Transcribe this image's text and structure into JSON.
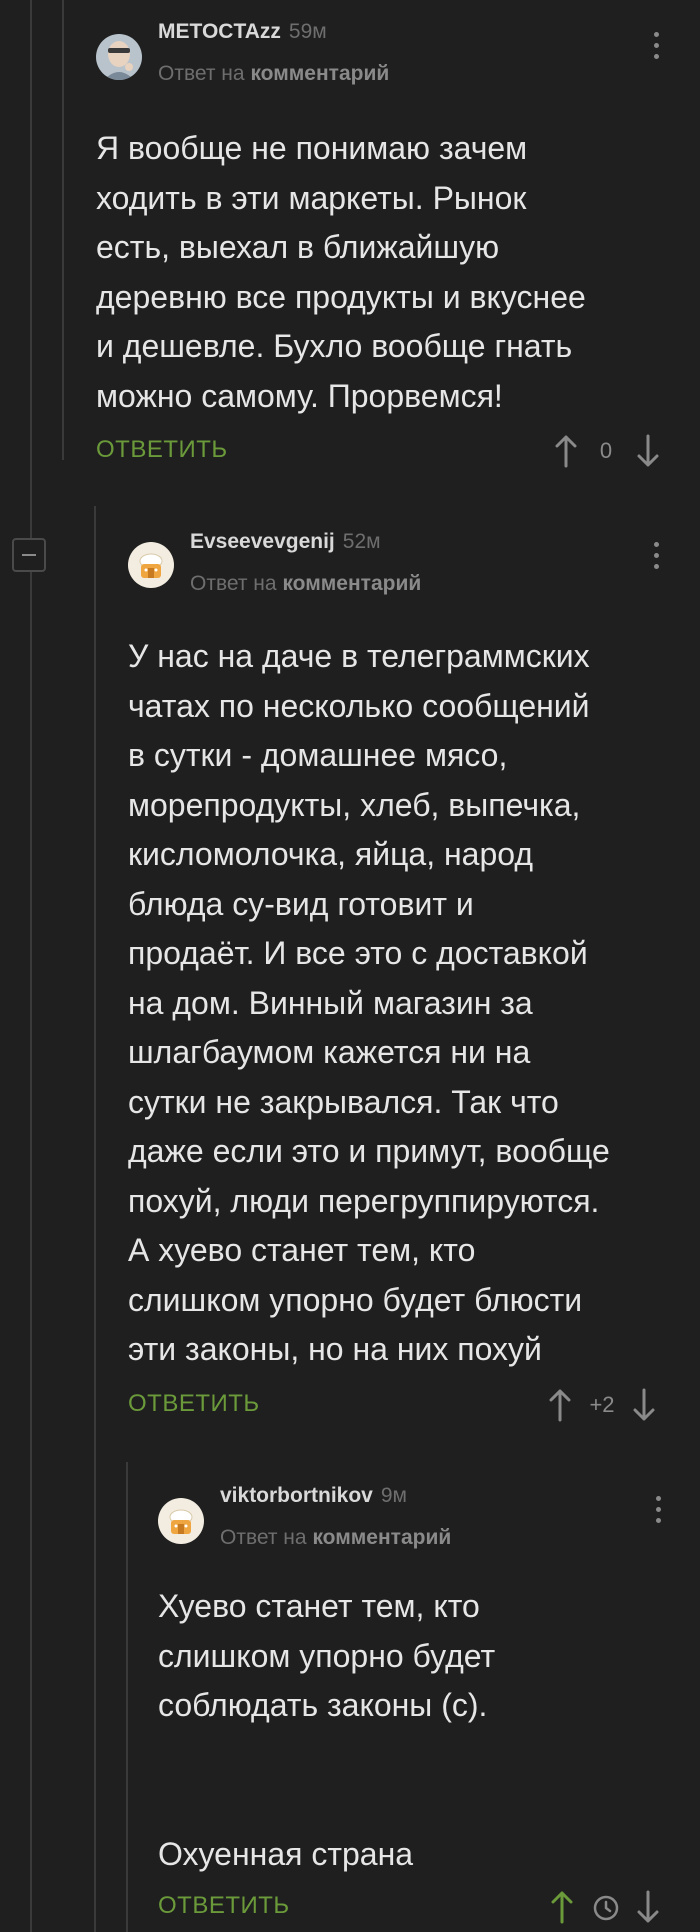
{
  "comments": [
    {
      "author": "METOCTAzz",
      "time": "59м",
      "reply_prefix": "Ответ на",
      "reply_target": "комментарий",
      "text": "Я вообще не понимаю зачем\nходить в эти маркеты. Рынок\nесть, выехал в ближайшую\nдеревню все продукты и вкуснее\nи дешевле. Бухло вообще гнать\nможно самому. Прорвемся!",
      "reply_label": "ОТВЕТИТЬ",
      "score": "0"
    },
    {
      "author": "Evseevevgenij",
      "time": "52м",
      "reply_prefix": "Ответ на",
      "reply_target": "комментарий",
      "text": "У нас на даче в телеграммских\nчатах по несколько сообщений\nв сутки - домашнее мясо,\nморепродукты, хлеб, выпечка,\nкисломолочка, яйца,  народ\nблюда су-вид готовит и\nпродаёт. И все это с доставкой\nна дом. Винный магазин за\nшлагбаумом кажется ни на\nсутки не закрывался. Так что\nдаже если это и примут, вообще\nпохуй, люди перегруппируются.\nА хуево станет тем, кто\nслишком упорно будет блюсти\nэти законы, но на них похуй",
      "reply_label": "ОТВЕТИТЬ",
      "score": "+2"
    },
    {
      "author": "viktorbortnikov",
      "time": "9м",
      "reply_prefix": "Ответ на",
      "reply_target": "комментарий",
      "text": "Хуево станет тем, кто\nслишком упорно будет\nсоблюдать законы (с).\n\n\nОхуенная страна",
      "reply_label": "ОТВЕТИТЬ",
      "score_icon": "clock-icon"
    }
  ],
  "colors": {
    "background": "#1f1f1f",
    "reply_green": "#6b9a3a",
    "upvote_active": "#6b9a3a",
    "muted": "#6e6e6e"
  }
}
